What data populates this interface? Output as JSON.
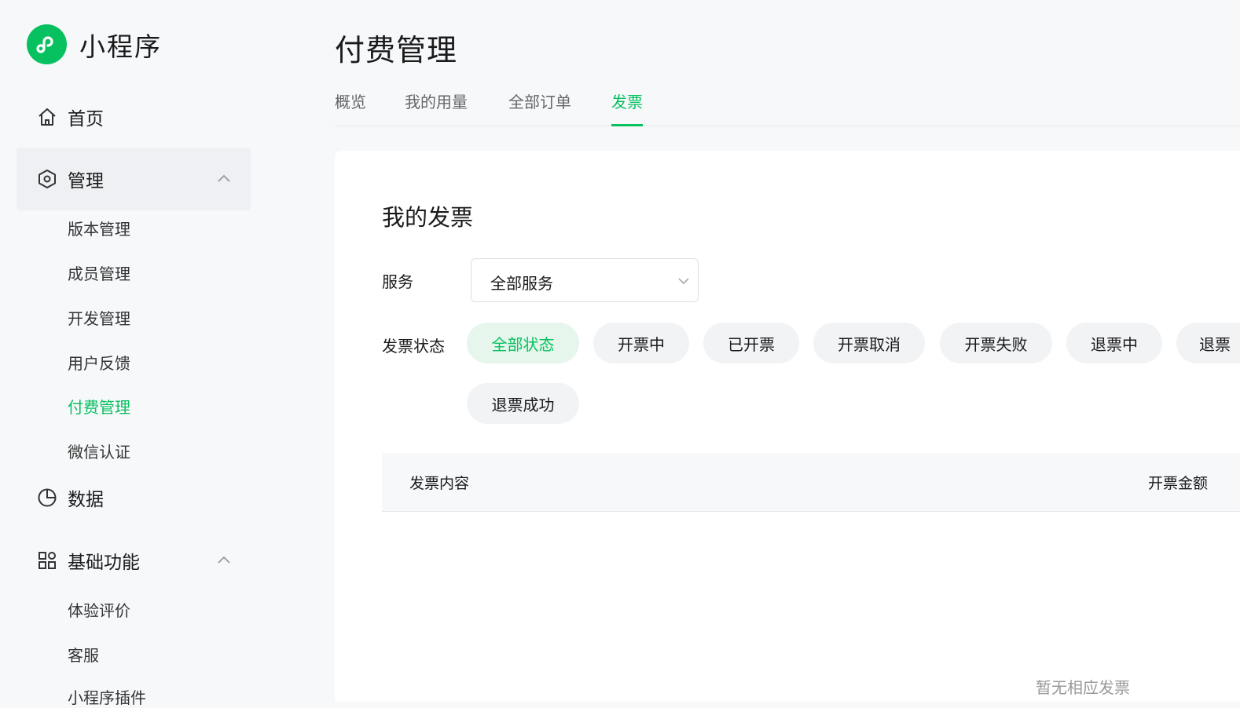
{
  "brand": {
    "name": "小程序",
    "color": "#07c160"
  },
  "sidebar": {
    "home": {
      "label": "首页",
      "icon": "home-icon"
    },
    "manage": {
      "label": "管理",
      "icon": "hexagon-settings-icon",
      "items": [
        {
          "label": "版本管理"
        },
        {
          "label": "成员管理"
        },
        {
          "label": "开发管理"
        },
        {
          "label": "用户反馈"
        },
        {
          "label": "付费管理"
        },
        {
          "label": "微信认证"
        }
      ]
    },
    "data": {
      "label": "数据",
      "icon": "pie-chart-icon"
    },
    "basic": {
      "label": "基础功能",
      "icon": "grid-apps-icon",
      "items": [
        {
          "label": "体验评价"
        },
        {
          "label": "客服"
        },
        {
          "label": "小程序插件"
        }
      ]
    }
  },
  "page": {
    "title": "付费管理",
    "tabs": [
      {
        "label": "概览"
      },
      {
        "label": "我的用量"
      },
      {
        "label": "全部订单"
      },
      {
        "label": "发票"
      }
    ],
    "active_tab": "发票"
  },
  "invoice": {
    "title": "我的发票",
    "service_label": "服务",
    "service_value": "全部服务",
    "status_label": "发票状态",
    "statuses": [
      {
        "label": "全部状态"
      },
      {
        "label": "开票中"
      },
      {
        "label": "已开票"
      },
      {
        "label": "开票取消"
      },
      {
        "label": "开票失败"
      },
      {
        "label": "退票中"
      },
      {
        "label": "退票"
      },
      {
        "label": "退票成功"
      }
    ],
    "active_status": "全部状态",
    "columns": [
      {
        "label": "发票内容"
      },
      {
        "label": "开票金额"
      }
    ],
    "empty_text": "暂无相应发票"
  }
}
